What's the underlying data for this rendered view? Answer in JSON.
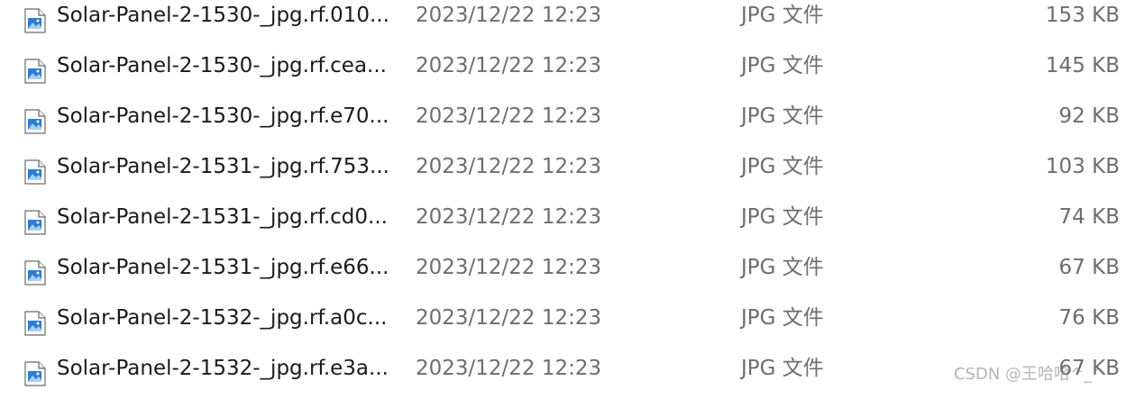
{
  "files": [
    {
      "name": "Solar-Panel-2-1530-_jpg.rf.010...",
      "date": "2023/12/22 12:23",
      "type": "JPG 文件",
      "size": "153 KB",
      "icon": "image-file-icon"
    },
    {
      "name": "Solar-Panel-2-1530-_jpg.rf.cea...",
      "date": "2023/12/22 12:23",
      "type": "JPG 文件",
      "size": "145 KB",
      "icon": "image-file-icon"
    },
    {
      "name": "Solar-Panel-2-1530-_jpg.rf.e70...",
      "date": "2023/12/22 12:23",
      "type": "JPG 文件",
      "size": "92 KB",
      "icon": "image-file-icon"
    },
    {
      "name": "Solar-Panel-2-1531-_jpg.rf.753...",
      "date": "2023/12/22 12:23",
      "type": "JPG 文件",
      "size": "103 KB",
      "icon": "image-file-icon"
    },
    {
      "name": "Solar-Panel-2-1531-_jpg.rf.cd0...",
      "date": "2023/12/22 12:23",
      "type": "JPG 文件",
      "size": "74 KB",
      "icon": "image-file-icon"
    },
    {
      "name": "Solar-Panel-2-1531-_jpg.rf.e66...",
      "date": "2023/12/22 12:23",
      "type": "JPG 文件",
      "size": "67 KB",
      "icon": "image-file-icon"
    },
    {
      "name": "Solar-Panel-2-1532-_jpg.rf.a0c...",
      "date": "2023/12/22 12:23",
      "type": "JPG 文件",
      "size": "76 KB",
      "icon": "image-file-icon"
    },
    {
      "name": "Solar-Panel-2-1532-_jpg.rf.e3a...",
      "date": "2023/12/22 12:23",
      "type": "JPG 文件",
      "size": "67 KB",
      "icon": "image-file-icon"
    }
  ],
  "watermark": "CSDN @王哈哈^_^",
  "colors": {
    "name_text": "#1a1a1a",
    "meta_text": "#6d6d6d",
    "icon_blue": "#2b7bd6",
    "icon_frame": "#6a6a6a"
  }
}
